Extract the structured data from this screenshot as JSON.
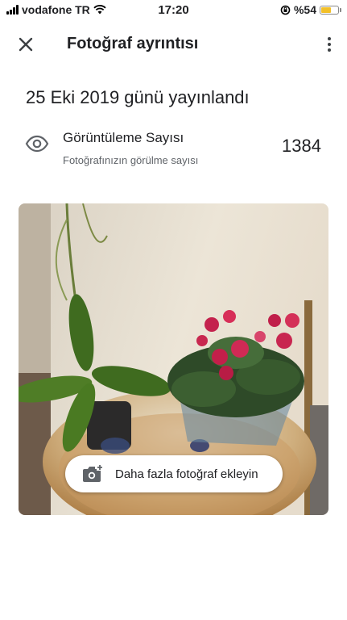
{
  "status_bar": {
    "carrier": "vodafone TR",
    "time": "17:20",
    "battery": "%54",
    "battery_level": 0.54
  },
  "header": {
    "title": "Fotoğraf ayrıntısı",
    "close_icon": "close-icon",
    "more_icon": "more-vert-icon"
  },
  "published": "25 Eki 2019 günü yayınlandı",
  "views": {
    "icon": "eye-icon",
    "title": "Görüntüleme Sayısı",
    "subtitle": "Fotoğrafınızın görülme sayısı",
    "count": "1384"
  },
  "photo": {
    "add_button_label": "Daha fazla fotoğraf ekleyin",
    "add_icon": "add-photo-icon"
  },
  "colors": {
    "text_primary": "#202124",
    "text_secondary": "#5f6368",
    "battery": "#f2c029"
  }
}
